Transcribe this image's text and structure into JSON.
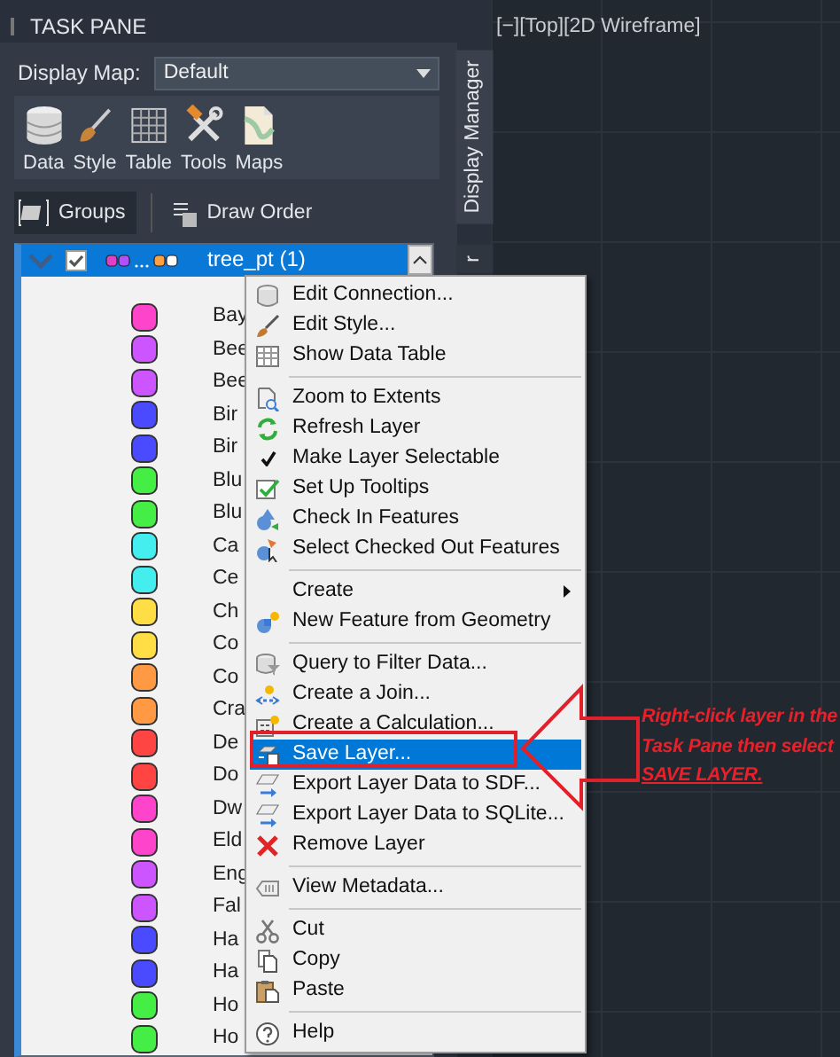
{
  "task_pane": {
    "title": "TASK PANE",
    "display_map": {
      "label": "Display Map:",
      "value": "Default"
    },
    "tools": [
      {
        "label": "Data"
      },
      {
        "label": "Style"
      },
      {
        "label": "Table"
      },
      {
        "label": "Tools"
      },
      {
        "label": "Maps"
      }
    ],
    "view_buttons": [
      {
        "label": "Groups",
        "selected": true
      },
      {
        "label": "Draw Order",
        "selected": false
      }
    ],
    "layer": {
      "name": "tree_pt (1)",
      "expanded": true,
      "visible": true,
      "selected": true,
      "styles": [
        {
          "label": "Bay",
          "color": "#ff44cc"
        },
        {
          "label": "Bee",
          "color": "#cc55ff"
        },
        {
          "label": "Bee",
          "color": "#cc55ff"
        },
        {
          "label": "Bir",
          "color": "#4a4aff"
        },
        {
          "label": "Bir",
          "color": "#4a4aff"
        },
        {
          "label": "Blu",
          "color": "#44ee44"
        },
        {
          "label": "Blu",
          "color": "#44ee44"
        },
        {
          "label": "Ca",
          "color": "#44eeee"
        },
        {
          "label": "Ce",
          "color": "#44eeee"
        },
        {
          "label": "Ch",
          "color": "#ffdd44"
        },
        {
          "label": "Co",
          "color": "#ffdd44"
        },
        {
          "label": "Co",
          "color": "#ff9944"
        },
        {
          "label": "Cra",
          "color": "#ff9944"
        },
        {
          "label": "De",
          "color": "#ff4444"
        },
        {
          "label": "Do",
          "color": "#ff4444"
        },
        {
          "label": "Dw",
          "color": "#ff44cc"
        },
        {
          "label": "Eld",
          "color": "#ff44cc"
        },
        {
          "label": "Eng",
          "color": "#cc55ff"
        },
        {
          "label": "Fal",
          "color": "#cc55ff"
        },
        {
          "label": "Ha",
          "color": "#4a4aff"
        },
        {
          "label": "Ha",
          "color": "#4a4aff"
        },
        {
          "label": "Ho",
          "color": "#44ee44"
        },
        {
          "label": "Ho",
          "color": "#44ee44"
        }
      ]
    }
  },
  "side_tabs": [
    {
      "label": "Display Manager",
      "selected": true
    },
    {
      "label": "r",
      "selected": false
    }
  ],
  "viewport": {
    "label": "[−][Top][2D Wireframe]"
  },
  "context_menu": [
    {
      "kind": "item",
      "label": "Edit Connection...",
      "selected": false
    },
    {
      "kind": "item",
      "label": "Edit Style...",
      "selected": false
    },
    {
      "kind": "item",
      "label": "Show Data Table",
      "selected": false
    },
    {
      "kind": "separator"
    },
    {
      "kind": "item",
      "label": "Zoom to Extents",
      "selected": false
    },
    {
      "kind": "item",
      "label": "Refresh Layer",
      "selected": false
    },
    {
      "kind": "check",
      "label": "Make Layer Selectable",
      "checked": true,
      "selected": false
    },
    {
      "kind": "item",
      "label": "Set Up Tooltips",
      "selected": false
    },
    {
      "kind": "item",
      "label": "Check In Features",
      "selected": false
    },
    {
      "kind": "item",
      "label": "Select Checked Out Features",
      "selected": false
    },
    {
      "kind": "separator"
    },
    {
      "kind": "submenu",
      "label": "Create",
      "selected": false
    },
    {
      "kind": "item",
      "label": "New Feature from Geometry",
      "selected": false
    },
    {
      "kind": "separator"
    },
    {
      "kind": "item",
      "label": "Query to Filter Data...",
      "selected": false
    },
    {
      "kind": "item",
      "label": "Create a Join...",
      "selected": false
    },
    {
      "kind": "item",
      "label": "Create a Calculation...",
      "selected": false
    },
    {
      "kind": "item",
      "label": "Save Layer...",
      "selected": true
    },
    {
      "kind": "item",
      "label": "Export Layer Data to SDF...",
      "selected": false
    },
    {
      "kind": "item",
      "label": "Export Layer Data to SQLite...",
      "selected": false
    },
    {
      "kind": "item",
      "label": "Remove Layer",
      "selected": false
    },
    {
      "kind": "separator"
    },
    {
      "kind": "item",
      "label": "View Metadata...",
      "selected": false
    },
    {
      "kind": "separator"
    },
    {
      "kind": "item",
      "label": "Cut",
      "selected": false
    },
    {
      "kind": "item",
      "label": "Copy",
      "selected": false
    },
    {
      "kind": "item",
      "label": "Paste",
      "selected": false
    },
    {
      "kind": "separator"
    },
    {
      "kind": "item",
      "label": "Help",
      "selected": false
    }
  ],
  "annotation": {
    "text": "Right-click layer in the Task Pane then select ",
    "emphasis": "SAVE LAYER."
  }
}
